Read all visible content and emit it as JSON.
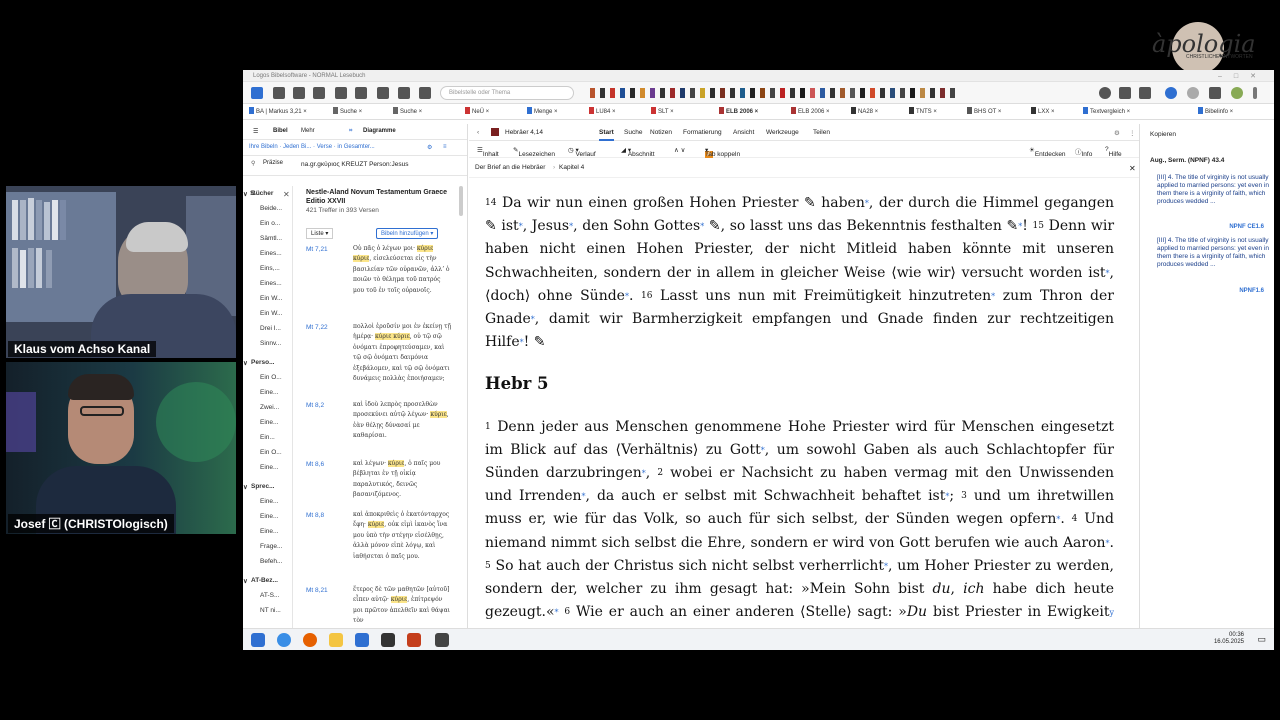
{
  "brand": {
    "logo_text": "àpologia",
    "logo_sub": "CHRISTLICHE\nANTWORTEN"
  },
  "cams": [
    {
      "label": "Klaus vom Achso Kanal"
    },
    {
      "label": "Josef 🄲 (CHRISTOlogisch)"
    }
  ],
  "window": {
    "title": "Logos Bibelsoftware - NORMAL Lesebuch"
  },
  "toolbar": {
    "search_placeholder": "Bibelstelle oder Thema"
  },
  "tabs": [
    "BA | Markus 3,21",
    "Suche",
    "Suche",
    "NeÜ",
    "Menge",
    "LU84",
    "SLT",
    "ELB 2006",
    "ELB 2006",
    "NA28",
    "TNTS",
    "BHS OT",
    "LXX",
    "Textvergleich",
    "Bibelinfo"
  ],
  "left": {
    "tabs": {
      "bibel": "Bibel",
      "mehr": "Mehr",
      "diagramme": "Diagramme"
    },
    "filter": "Ihre Bibeln · Jeden Bi... · Verse · in Gesamter...",
    "query_label": "Präzise",
    "query": "na.gr.gκύριος KREUZT Person:Jesus",
    "s_label": "S...",
    "result_title": "Nestle-Aland Novum Testamentum Graece Editio XXVII",
    "result_count": "421 Treffer in 393 Versen",
    "list_btn": "Liste",
    "add_btn": "Bibeln hinzufügen",
    "nav": [
      {
        "type": "head",
        "text": "Bücher"
      },
      {
        "type": "item",
        "text": "Beide..."
      },
      {
        "type": "item",
        "text": "Ein o..."
      },
      {
        "type": "item",
        "text": "Sämtl..."
      },
      {
        "type": "item",
        "text": "Eines..."
      },
      {
        "type": "item",
        "text": "Eins,..."
      },
      {
        "type": "item",
        "text": "Eines..."
      },
      {
        "type": "item",
        "text": "Ein W..."
      },
      {
        "type": "item",
        "text": "Ein W..."
      },
      {
        "type": "item",
        "text": "Drei I..."
      },
      {
        "type": "item",
        "text": "Sinnv..."
      },
      {
        "type": "head",
        "text": "Perso..."
      },
      {
        "type": "item",
        "text": "Ein O..."
      },
      {
        "type": "item",
        "text": "Eine..."
      },
      {
        "type": "item",
        "text": "Zwei..."
      },
      {
        "type": "item",
        "text": "Eine..."
      },
      {
        "type": "item",
        "text": "Ein..."
      },
      {
        "type": "item",
        "text": "Ein O..."
      },
      {
        "type": "item",
        "text": "Eine..."
      },
      {
        "type": "head",
        "text": "Sprec..."
      },
      {
        "type": "item",
        "text": "Eine..."
      },
      {
        "type": "item",
        "text": "Eine..."
      },
      {
        "type": "item",
        "text": "Eine..."
      },
      {
        "type": "item",
        "text": "Frage..."
      },
      {
        "type": "item",
        "text": "Befeh..."
      },
      {
        "type": "head",
        "text": "AT-Bez..."
      },
      {
        "type": "item",
        "text": "AT-S..."
      },
      {
        "type": "item",
        "text": "NT ni..."
      }
    ],
    "results": [
      {
        "ref": "Mt 7,21",
        "pre": "Οὐ πᾶς ὁ λέγων μοι· ",
        "hit": "κύριε κύριε",
        "post": ", εἰσελεύσεται εἰς τὴν βασιλείαν τῶν οὐρανῶν, ἀλλʼ ὁ ποιῶν τὸ θέλημα τοῦ πατρός μου τοῦ ἐν τοῖς οὐρανοῖς."
      },
      {
        "ref": "Mt 7,22",
        "pre": "πολλοὶ ἐροῦσίν μοι ἐν ἐκείνῃ τῇ ἡμέρᾳ· ",
        "hit": "κύριε κύριε",
        "post": ", οὐ τῷ σῷ ὀνόματι ἐπροφητεύσαμεν, καὶ τῷ σῷ ὀνόματι δαιμόνια ἐξεβάλομεν, καὶ τῷ σῷ ὀνόματι δυνάμεις πολλὰς ἐποιήσαμεν;"
      },
      {
        "ref": "Mt 8,2",
        "pre": "καὶ ἰδοὺ λεπρὸς προσελθὼν προσεκύνει αὐτῷ λέγων· ",
        "hit": "κύριε",
        "post": ", ἐὰν θέλῃς δύνασαί με καθαρίσαι."
      },
      {
        "ref": "Mt 8,6",
        "pre": "καὶ λέγων· ",
        "hit": "κύριε",
        "post": ", ὁ παῖς μου βέβληται ἐν τῇ οἰκίᾳ παραλυτικός, δεινῶς βασανιζόμενος."
      },
      {
        "ref": "Mt 8,8",
        "pre": "καὶ ἀποκριθεὶς ὁ ἑκατόνταρχος ἔφη· ",
        "hit": "κύριε",
        "post": ", οὐκ εἰμὶ ἱκανὸς ἵνα μου ὑπὸ τὴν στέγην εἰσέλθῃς, ἀλλὰ μόνον εἰπὲ λόγῳ, καὶ ἰαθήσεται ὁ παῖς μου."
      },
      {
        "ref": "Mt 8,21",
        "pre": "ἕτερος δὲ τῶν μαθητῶν [αὐτοῦ] εἶπεν αὐτῷ· ",
        "hit": "κύριε",
        "post": ", ἐπίτρεψόν μοι πρῶτον ἀπελθεῖν καὶ θάψαι τὸν"
      }
    ]
  },
  "reader": {
    "location": "Hebräer 4,14",
    "menu": [
      "Start",
      "Suche",
      "Notizen",
      "Formatierung",
      "Ansicht",
      "Werkzeuge",
      "Teilen"
    ],
    "tools": [
      "Inhalt",
      "Lesezeichen",
      "Verlauf",
      "Abschnitt",
      "Tab koppeln",
      "Entdecken",
      "Info",
      "Hilfe"
    ],
    "crumb1": "Der Brief an die Hebräer",
    "crumb2": "Kapitel 4",
    "heading": "Hebr 5"
  },
  "notes": {
    "title": "Kopieren",
    "source": "Aug., Serm. (NPNF) 43.4",
    "items": [
      {
        "text": "[III] 4. The title of virginity is not usually applied to married persons: yet even in them there is a virginity of faith, which produces wedded ...",
        "link": "NPNF CE1.6"
      },
      {
        "text": "[III] 4. The title of virginity is not usually applied to married persons: yet even in them there is a virginity of faith, which produces wedded ...",
        "link": "NPNF1.6"
      }
    ]
  },
  "taskbar": {
    "time": "00:36",
    "date": "16.05.2025"
  },
  "colors": {
    "accent": "#2f6fd1",
    "highlight": "#fbe58a"
  }
}
